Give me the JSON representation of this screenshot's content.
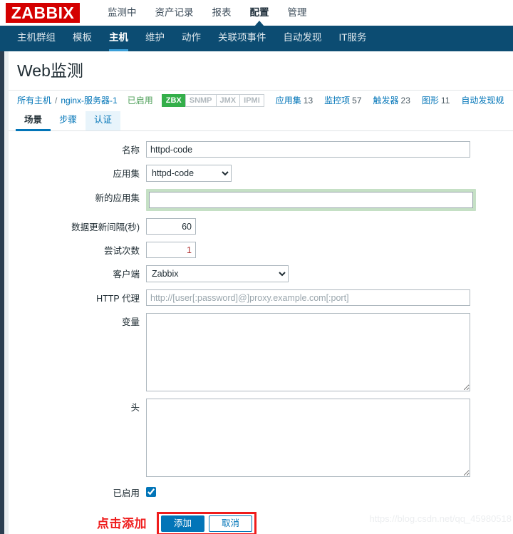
{
  "app": {
    "logo": "ZABBIX",
    "top_nav": [
      {
        "label": "监测中",
        "active": false
      },
      {
        "label": "资产记录",
        "active": false
      },
      {
        "label": "报表",
        "active": false
      },
      {
        "label": "配置",
        "active": true
      },
      {
        "label": "管理",
        "active": false
      }
    ],
    "sub_nav": [
      {
        "label": "主机群组",
        "active": false
      },
      {
        "label": "模板",
        "active": false
      },
      {
        "label": "主机",
        "active": true
      },
      {
        "label": "维护",
        "active": false
      },
      {
        "label": "动作",
        "active": false
      },
      {
        "label": "关联项事件",
        "active": false
      },
      {
        "label": "自动发现",
        "active": false
      },
      {
        "label": "IT服务",
        "active": false
      }
    ]
  },
  "page": {
    "title": "Web监测"
  },
  "breadcrumb": {
    "all_hosts": "所有主机",
    "separator": "/",
    "host": "nginx-服务器-1",
    "status": "已启用",
    "badges": [
      {
        "label": "ZBX",
        "enabled": true
      },
      {
        "label": "SNMP",
        "enabled": false
      },
      {
        "label": "JMX",
        "enabled": false
      },
      {
        "label": "IPMI",
        "enabled": false
      }
    ],
    "counts": [
      {
        "label": "应用集",
        "value": "13"
      },
      {
        "label": "监控项",
        "value": "57"
      },
      {
        "label": "触发器",
        "value": "23"
      },
      {
        "label": "图形",
        "value": "11"
      },
      {
        "label": "自动发现规",
        "value": ""
      }
    ]
  },
  "tabs": [
    {
      "label": "场景",
      "state": "active"
    },
    {
      "label": "步骤",
      "state": "normal"
    },
    {
      "label": "认证",
      "state": "hover"
    }
  ],
  "form": {
    "name": {
      "label": "名称",
      "value": "httpd-code"
    },
    "application": {
      "label": "应用集",
      "value": "httpd-code",
      "options": [
        "httpd-code"
      ]
    },
    "new_application": {
      "label": "新的应用集",
      "value": "",
      "placeholder": ""
    },
    "update_interval": {
      "label": "数据更新间隔(秒)",
      "value": "60"
    },
    "retries": {
      "label": "尝试次数",
      "value": "1"
    },
    "agent": {
      "label": "客户端",
      "value": "Zabbix",
      "options": [
        "Zabbix"
      ]
    },
    "http_proxy": {
      "label": "HTTP 代理",
      "value": "",
      "placeholder": "http://[user[:password]@]proxy.example.com[:port]"
    },
    "variables": {
      "label": "变量",
      "value": ""
    },
    "headers": {
      "label": "头",
      "value": ""
    },
    "enabled": {
      "label": "已启用",
      "checked": true
    }
  },
  "footer": {
    "annotation": "点击添加",
    "add_label": "添加",
    "cancel_label": "取消"
  },
  "watermark": "https://blog.csdn.net/qq_45980518"
}
